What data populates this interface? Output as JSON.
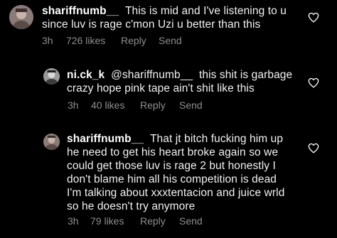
{
  "comments": [
    {
      "username": "shariffnumb__",
      "text": "This is mid and I've listening to u since luv is rage c'mon Uzi u better than this",
      "lines": [
        "This is mid and I've listening to u",
        "since luv is rage c'mon Uzi u better than this"
      ],
      "time": "3h",
      "likes": "726 likes",
      "reply": "Reply",
      "send": "Send",
      "icon": "heart-outline-icon"
    },
    {
      "username": "ni.ck_k",
      "mention": "@shariffnumb__",
      "text": "this shit is garbage crazy hope pink tape ain't shit like this",
      "lines": [
        "this shit is garbage",
        "crazy hope pink tape ain't shit like this"
      ],
      "time": "3h",
      "likes": "40 likes",
      "reply": "Reply",
      "send": "Send",
      "icon": "heart-outline-icon"
    },
    {
      "username": "shariffnumb__",
      "text": "That jt bitch fucking him up he need to get his heart broke again so we could get those luv is rage 2 but honestly I don't blame him all his competition is dead I'm talking about xxxtentacion and juice wrld so he doesn't try anymore",
      "lines": [
        "That jt bitch fucking him up",
        "he need to get his heart broke again so we",
        "could get those luv is rage 2 but honestly I",
        "don't blame him all his competition is dead",
        "I'm talking about xxxtentacion and juice wrld",
        "so he doesn't try anymore"
      ],
      "time": "3h",
      "likes": "79 likes",
      "reply": "Reply",
      "send": "Send",
      "icon": "heart-outline-icon"
    }
  ],
  "colors": {
    "background": "#000000",
    "text": "#f2f2f2",
    "meta": "#8e8e8e"
  }
}
